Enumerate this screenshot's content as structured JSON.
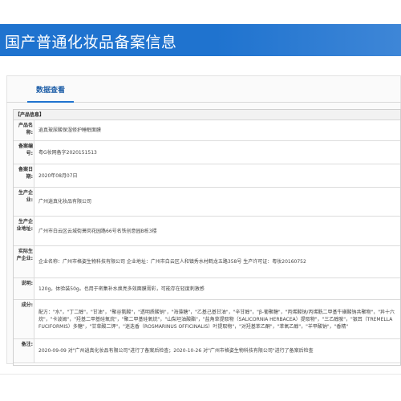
{
  "header": {
    "title": "国产普通化妆品备案信息"
  },
  "tabs": [
    {
      "label": "数据查看"
    }
  ],
  "product_info": {
    "section_title": "【产品信息】",
    "fields": [
      {
        "label": "产品名称:",
        "value": "逍真玻尿酸保湿修护睡眠面膜"
      },
      {
        "label": "备案编号:",
        "value": "粤G妆网备字2020151513"
      },
      {
        "label": "备案日期:",
        "value": "2020年08月07日"
      },
      {
        "label": "生产企业:",
        "value": "广州逍真化妆品有限公司"
      },
      {
        "label": "生产企业地址:",
        "value": "广州市白云区云城街萧岗花园路66号名铁创意园B栋3楼"
      },
      {
        "label": "实际生产企业:",
        "value": "企业名称：广州市格姿生物科技有限公司 企业地址：广州市白云区人和镇秀水村鹤龙五路358号 生产许可证：粤妆20160752"
      },
      {
        "label": "说明:",
        "value": "120g，体验装50g。也用于密集补水焕亮多效面膜膏彩，可能存在轻度刺激感"
      },
      {
        "label": "成分:",
        "value": "配方：\"水\"，\"丁二醇\"，\"甘油\"，\"聚谷氨酸\"，\"透明质酸钠\"，\"海藻糖\"，\"乙基己基甘油\"，\"辛甘醇\"，\"β-葡聚糖\"，\"丙烯酸钠/丙烯酰二甲基牛磺酸钠共聚物\"，\"异十六烷\"，\"卡波姆\"，\"羟基二甲基硅氧烷\"，\"聚二甲基硅氧烷\"，\"山梨坦油酸酯\"，\"盐角草提取物（SALICORNIA HERBACEA）提取物\"，\"三乙醇胺\"，\"银耳（TREMELLA FUCIFORMIS）多糖\"，\"甘草酸二钾\"，\"迷迭香（ROSMARINUS OFFICINALIS）叶提取物\"，\"对羟基苯乙酮\"，\"苯氧乙醇\"，\"羊甲酸钠\"，\"香精\""
      },
      {
        "label": "备注:",
        "value": "2020-09-09 对\"广州逍真化妆品有限公司\"进行了备案后检查；2020-10-26 对\"广州市格姿生物科技有限公司\"进行了备案后检查"
      }
    ]
  },
  "colors": {
    "banner": "#1f73cf",
    "tab_accent": "#1f73cf"
  }
}
